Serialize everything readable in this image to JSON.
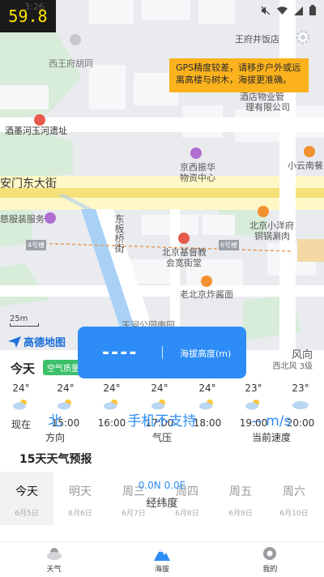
{
  "status_bar": {
    "fps": "59.8",
    "time": "3:26"
  },
  "map": {
    "warning": "GPS精度较差，请移步户外或远离高楼与树木，海拔更准确。",
    "labels": {
      "wangfu": "王府井饭店",
      "xiwang": "西王府胡同",
      "property_1": "酒店物业管",
      "property_2": "理有限公司",
      "yuhe": "酒墨河玉河遗址",
      "jingxi_1": "京西振华",
      "jingxi_2": "物资中心",
      "xiaoyun": "小云南餐",
      "andong": "安门东大街",
      "shop": "慈服装服务",
      "donganqiao": "东板桥街",
      "xiaoyangfu_1": "北京小洋府",
      "xiaoyangfu_2": "铜锅涮肉",
      "church_1": "北京基督教",
      "church_2": "会宽街堂",
      "zhajiang": "老北京炸酱面",
      "park": "玉河公园南园",
      "road_4": "4号楼",
      "road_6": "6号楼"
    },
    "scale": "25m",
    "logo": "高德地图"
  },
  "altitude": {
    "value": "----",
    "label": "海拔高度(m)"
  },
  "weather": {
    "today": "今天",
    "aqi": "空气质量",
    "wind_dir": "风向",
    "wind_level": "西北风 3级",
    "hourly": [
      {
        "temp": "24°",
        "time": "现在"
      },
      {
        "temp": "24°",
        "time": "15:00"
      },
      {
        "temp": "24°",
        "time": "16:00"
      },
      {
        "temp": "24°",
        "time": "17:00"
      },
      {
        "temp": "24°",
        "time": "18:00"
      },
      {
        "temp": "23°",
        "time": "19:00"
      },
      {
        "temp": "23°",
        "time": "20:00"
      }
    ],
    "direction": {
      "value": "北",
      "label": "方向"
    },
    "pressure": {
      "value": "手机不支持",
      "label": "气压"
    },
    "speed": {
      "value": "-- m/s",
      "label": "当前速度"
    },
    "forecast_title": "15天天气预报",
    "days": [
      {
        "name": "今天",
        "date": "6月5日"
      },
      {
        "name": "明天",
        "date": "6月6日"
      },
      {
        "name": "周三",
        "date": "6月7日"
      },
      {
        "name": "周四",
        "date": "6月8日"
      },
      {
        "name": "周五",
        "date": "6月9日"
      },
      {
        "name": "周六",
        "date": "6月10日"
      }
    ],
    "coordinates": {
      "value": "0.0N 0.0E",
      "label": "经纬度"
    }
  },
  "nav": {
    "weather": "天气",
    "altitude": "海拔",
    "mine": "我的"
  },
  "colors": {
    "accent": "#2d8cf5",
    "warning": "#fbb21d",
    "aqi": "#3cc06a"
  }
}
